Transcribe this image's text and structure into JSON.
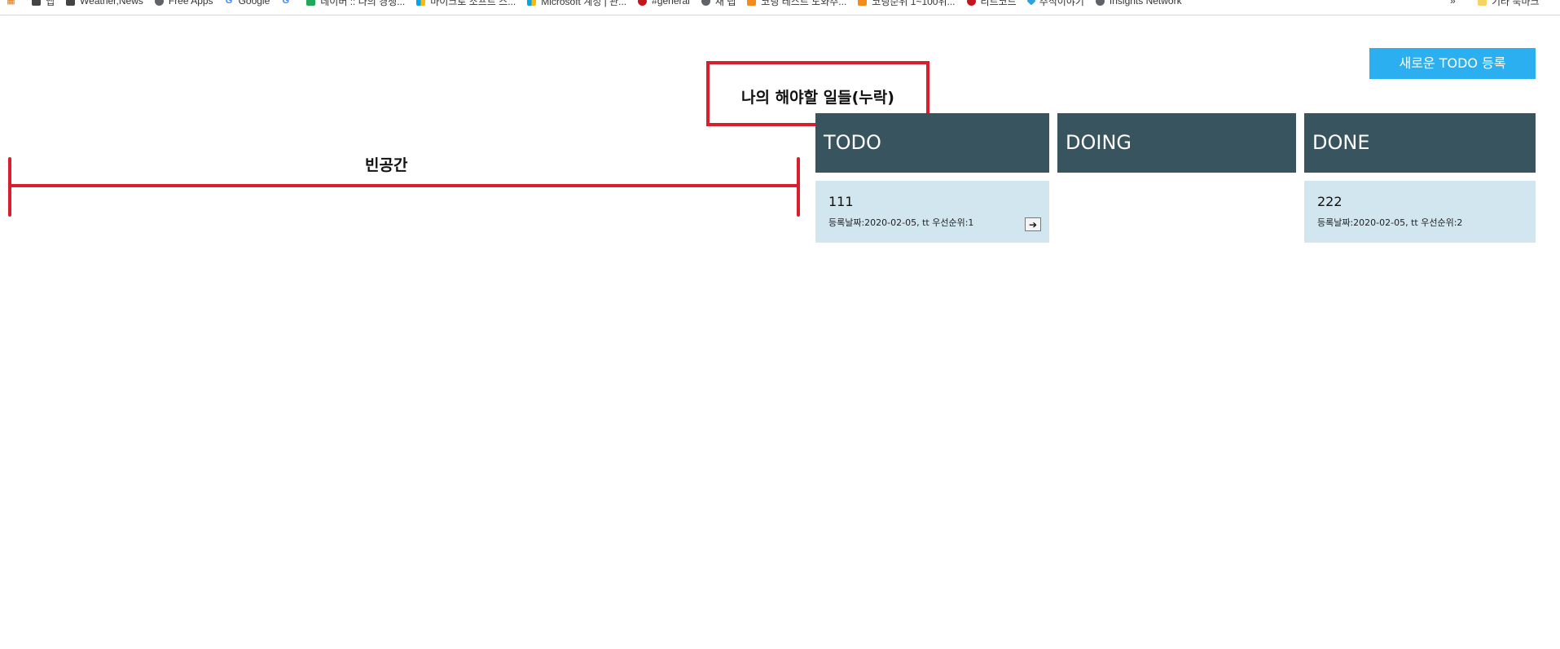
{
  "bookmarks": {
    "items": [
      {
        "label": "",
        "icon": "apps-grid-icon"
      },
      {
        "label": "앱",
        "icon": "doc-icon"
      },
      {
        "label": "Weather,News",
        "icon": "page-icon"
      },
      {
        "label": "Free Apps",
        "icon": "globe-icon"
      },
      {
        "label": "Google",
        "icon": "google-icon"
      },
      {
        "label": "",
        "icon": "google-icon"
      },
      {
        "label": "네이버 :: 나의 경쟁...",
        "icon": "naver-icon"
      },
      {
        "label": "마이크로 소프트 스...",
        "icon": "microsoft-icon"
      },
      {
        "label": "Microsoft 계정 | 관...",
        "icon": "microsoft-icon"
      },
      {
        "label": "#general",
        "icon": "slack-icon"
      },
      {
        "label": "새 탭",
        "icon": "globe-icon"
      },
      {
        "label": "코딩 테스트 도와주...",
        "icon": "image-icon"
      },
      {
        "label": "코딩순위 1~100위...",
        "icon": "pencil-icon"
      },
      {
        "label": "리트코드",
        "icon": "slack-icon"
      },
      {
        "label": "주식이야기",
        "icon": "diamond-icon"
      },
      {
        "label": "Insights Network",
        "icon": "globe-icon"
      }
    ],
    "overflow_label": "»",
    "other_label": "기타 북마크"
  },
  "new_todo_button": {
    "label": "새로운 TODO 등록"
  },
  "annotations": {
    "missing_title": "나의 해야할 일들(누락)",
    "empty_space": "빈공간",
    "accent_color": "#d91e2d"
  },
  "columns": [
    {
      "title": "TODO",
      "cards": [
        {
          "title": "111",
          "meta": "등록날짜:2020-02-05, tt 우선순위:1",
          "action": "➔"
        }
      ]
    },
    {
      "title": "DOING",
      "cards": []
    },
    {
      "title": "DONE",
      "cards": [
        {
          "title": "222",
          "meta": "등록날짜:2020-02-05, tt 우선순위:2"
        }
      ]
    }
  ],
  "colors": {
    "header_bg": "#37545f",
    "card_bg": "#d1e6ee",
    "button_bg": "#2baff0"
  }
}
